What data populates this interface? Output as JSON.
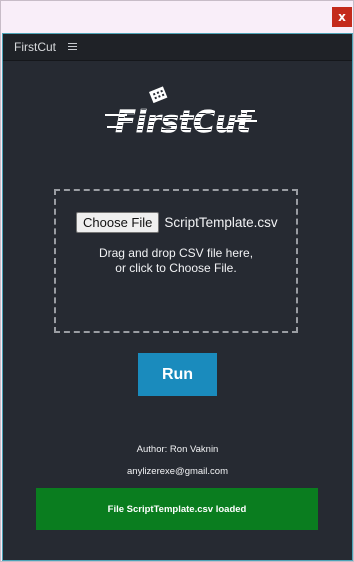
{
  "window": {
    "close_glyph": "x"
  },
  "panel": {
    "title": "FirstCut",
    "menu_icon": "hamburger-menu-icon",
    "border_color": "#4ea4b7"
  },
  "logo": {
    "text": "FirstCut"
  },
  "dropzone": {
    "choose_file_label": "Choose File",
    "file_name": "ScriptTemplate.csv",
    "instruction_line1": "Drag and drop CSV file here,",
    "instruction_line2": "or click to Choose File."
  },
  "run_button": {
    "label": "Run",
    "color": "#1a8bbd"
  },
  "footer": {
    "author": "Author: Ron Vaknin",
    "email": "anylizerexe@gmail.com"
  },
  "status": {
    "message": "File ScriptTemplate.csv loaded",
    "color": "#0a7d1f"
  }
}
